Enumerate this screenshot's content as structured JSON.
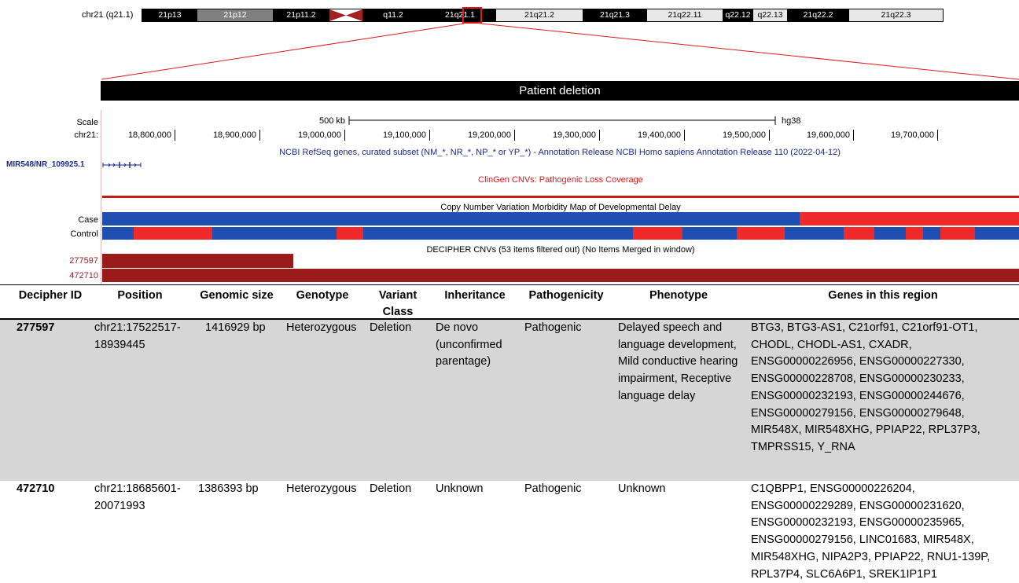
{
  "ideogram": {
    "label": "chr21 (q21.1)",
    "bands": [
      {
        "name": "21p13",
        "color": "#000000",
        "text": "#ffffff"
      },
      {
        "name": "21p12",
        "color": "#808080",
        "text": "#ffffff"
      },
      {
        "name": "21p11.2",
        "color": "#000000",
        "text": "#ffffff"
      },
      {
        "name": "",
        "color": "#ffffff",
        "text": "#000000"
      },
      {
        "name": "q11.2",
        "color": "#000000",
        "text": "#ffffff"
      },
      {
        "name": "21q21.1",
        "color": "#000000",
        "text": "#ffffff"
      },
      {
        "name": "21q21.2",
        "color": "#e8e8e8",
        "text": "#000000"
      },
      {
        "name": "21q21.3",
        "color": "#000000",
        "text": "#ffffff"
      },
      {
        "name": "21q22.11",
        "color": "#e8e8e8",
        "text": "#000000"
      },
      {
        "name": "q22.12",
        "color": "#000000",
        "text": "#ffffff"
      },
      {
        "name": "q22.13",
        "color": "#e8e8e8",
        "text": "#000000"
      },
      {
        "name": "21q22.2",
        "color": "#000000",
        "text": "#ffffff"
      },
      {
        "name": "21q22.3",
        "color": "#e8e8e8",
        "text": "#000000"
      }
    ],
    "centromere_color": "#a52020",
    "highlight_color": "#e01818"
  },
  "banner": {
    "title": "Patient deletion"
  },
  "browser": {
    "scale_label": "Scale",
    "chrom_label": "chr21:",
    "scale_bar_text": "500 kb",
    "assembly": "hg38",
    "positions": [
      "18,800,000",
      "18,900,000",
      "19,000,000",
      "19,100,000",
      "19,200,000",
      "19,300,000",
      "19,400,000",
      "19,500,000",
      "19,600,000",
      "19,700,000"
    ],
    "refseq_title": "NCBI RefSeq genes, curated subset (NM_*, NR_*, NP_* or YP_*) - Annotation Release NCBI Homo sapiens Annotation Release 110 (2022-04-12)",
    "gene_label": "MIR548/NR_109925.1",
    "clingen_title": "ClinGen CNVs: Pathogenic Loss Coverage",
    "cnv_map_title": "Copy Number Variation Morbidity Map of Developmental Delay",
    "case_label": "Case",
    "control_label": "Control",
    "decipher_title": "DECIPHER CNVs (53 items filtered out) (No Items Merged in window)",
    "decipher_ids": [
      "277597",
      "472710"
    ],
    "colors": {
      "blue": "#1f4fb0",
      "red": "#ee2a2a",
      "darkred": "#9b1b1b",
      "navy": "#1a2a8a"
    }
  },
  "table": {
    "headers": [
      "Decipher ID",
      "Position",
      "Genomic size",
      "Genotype",
      "Variant Class",
      "Inheritance",
      "Pathogenicity",
      "Phenotype",
      "Genes in this region"
    ],
    "rows": [
      {
        "id": "277597",
        "position": "chr21:17522517-18939445",
        "size": "1416929 bp",
        "genotype": "Heterozygous",
        "variant_class": "Deletion",
        "inheritance": "De novo (unconfirmed parentage)",
        "pathogenicity": "Pathogenic",
        "phenotype": "Delayed speech and language development, Mild conductive hearing impairment, Receptive language delay",
        "genes": "BTG3, BTG3-AS1, C21orf91, C21orf91-OT1, CHODL, CHODL-AS1, CXADR, ENSG00000226956, ENSG00000227330, ENSG00000228708, ENSG00000230233, ENSG00000232193, ENSG00000244676, ENSG00000279156, ENSG00000279648, MIR548X, MIR548XHG, PPIAP22, RPL37P3, TMPRSS15, Y_RNA"
      },
      {
        "id": "472710",
        "position": "chr21:18685601-20071993",
        "size": "1386393 bp",
        "genotype": "Heterozygous",
        "variant_class": "Deletion",
        "inheritance": "Unknown",
        "pathogenicity": "Pathogenic",
        "phenotype": "Unknown",
        "genes": "C1QBPP1, ENSG00000226204, ENSG00000229289, ENSG00000231620, ENSG00000232193, ENSG00000235965, ENSG00000279156, LINC01683, MIR548X, MIR548XHG, NIPA2P3, PPIAP22, RNU1-139P, RPL37P4, SLC6A6P1, SREK1IP1P1"
      }
    ]
  }
}
